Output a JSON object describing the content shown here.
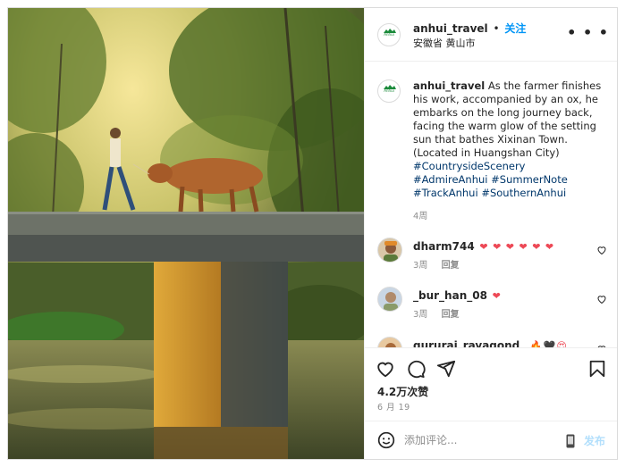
{
  "post": {
    "username": "anhui_travel",
    "dot": "•",
    "follow_label": "关注",
    "location": "安徽省 黄山市",
    "avatar_text": "Anhui",
    "more_icon": "more-horizontal-icon"
  },
  "caption": {
    "username": "anhui_travel",
    "text": "As the farmer finishes his work, accompanied by an ox, he embarks on the long journey back, facing the warm glow of the setting sun that bathes Xixinan Town. (Located in Huangshan City)",
    "hashtags": [
      "#CountrysideScenery",
      "#AdmireAnhui",
      "#SummerNote",
      "#TrackAnhui",
      "#SouthernAnhui"
    ],
    "time": "4周"
  },
  "comments": [
    {
      "username": "dharm744",
      "emoji": "❤ ❤ ❤ ❤ ❤ ❤",
      "time": "3周",
      "reply": "回复"
    },
    {
      "username": "_bur_han_08",
      "emoji": "❤",
      "time": "3周",
      "reply": "回复"
    },
    {
      "username": "gururaj_rayagond_",
      "emoji": "🔥🖤😍",
      "time": "",
      "reply": ""
    }
  ],
  "actions": {
    "likes": "4.2万次赞",
    "date": "6 月 19"
  },
  "comment_bar": {
    "placeholder": "添加评论...",
    "post_label": "发布"
  },
  "colors": {
    "link": "#0095f6",
    "hashtag": "#00376b",
    "heart": "#ed4956",
    "muted": "#8e8e8e",
    "border": "#dbdbdb"
  }
}
